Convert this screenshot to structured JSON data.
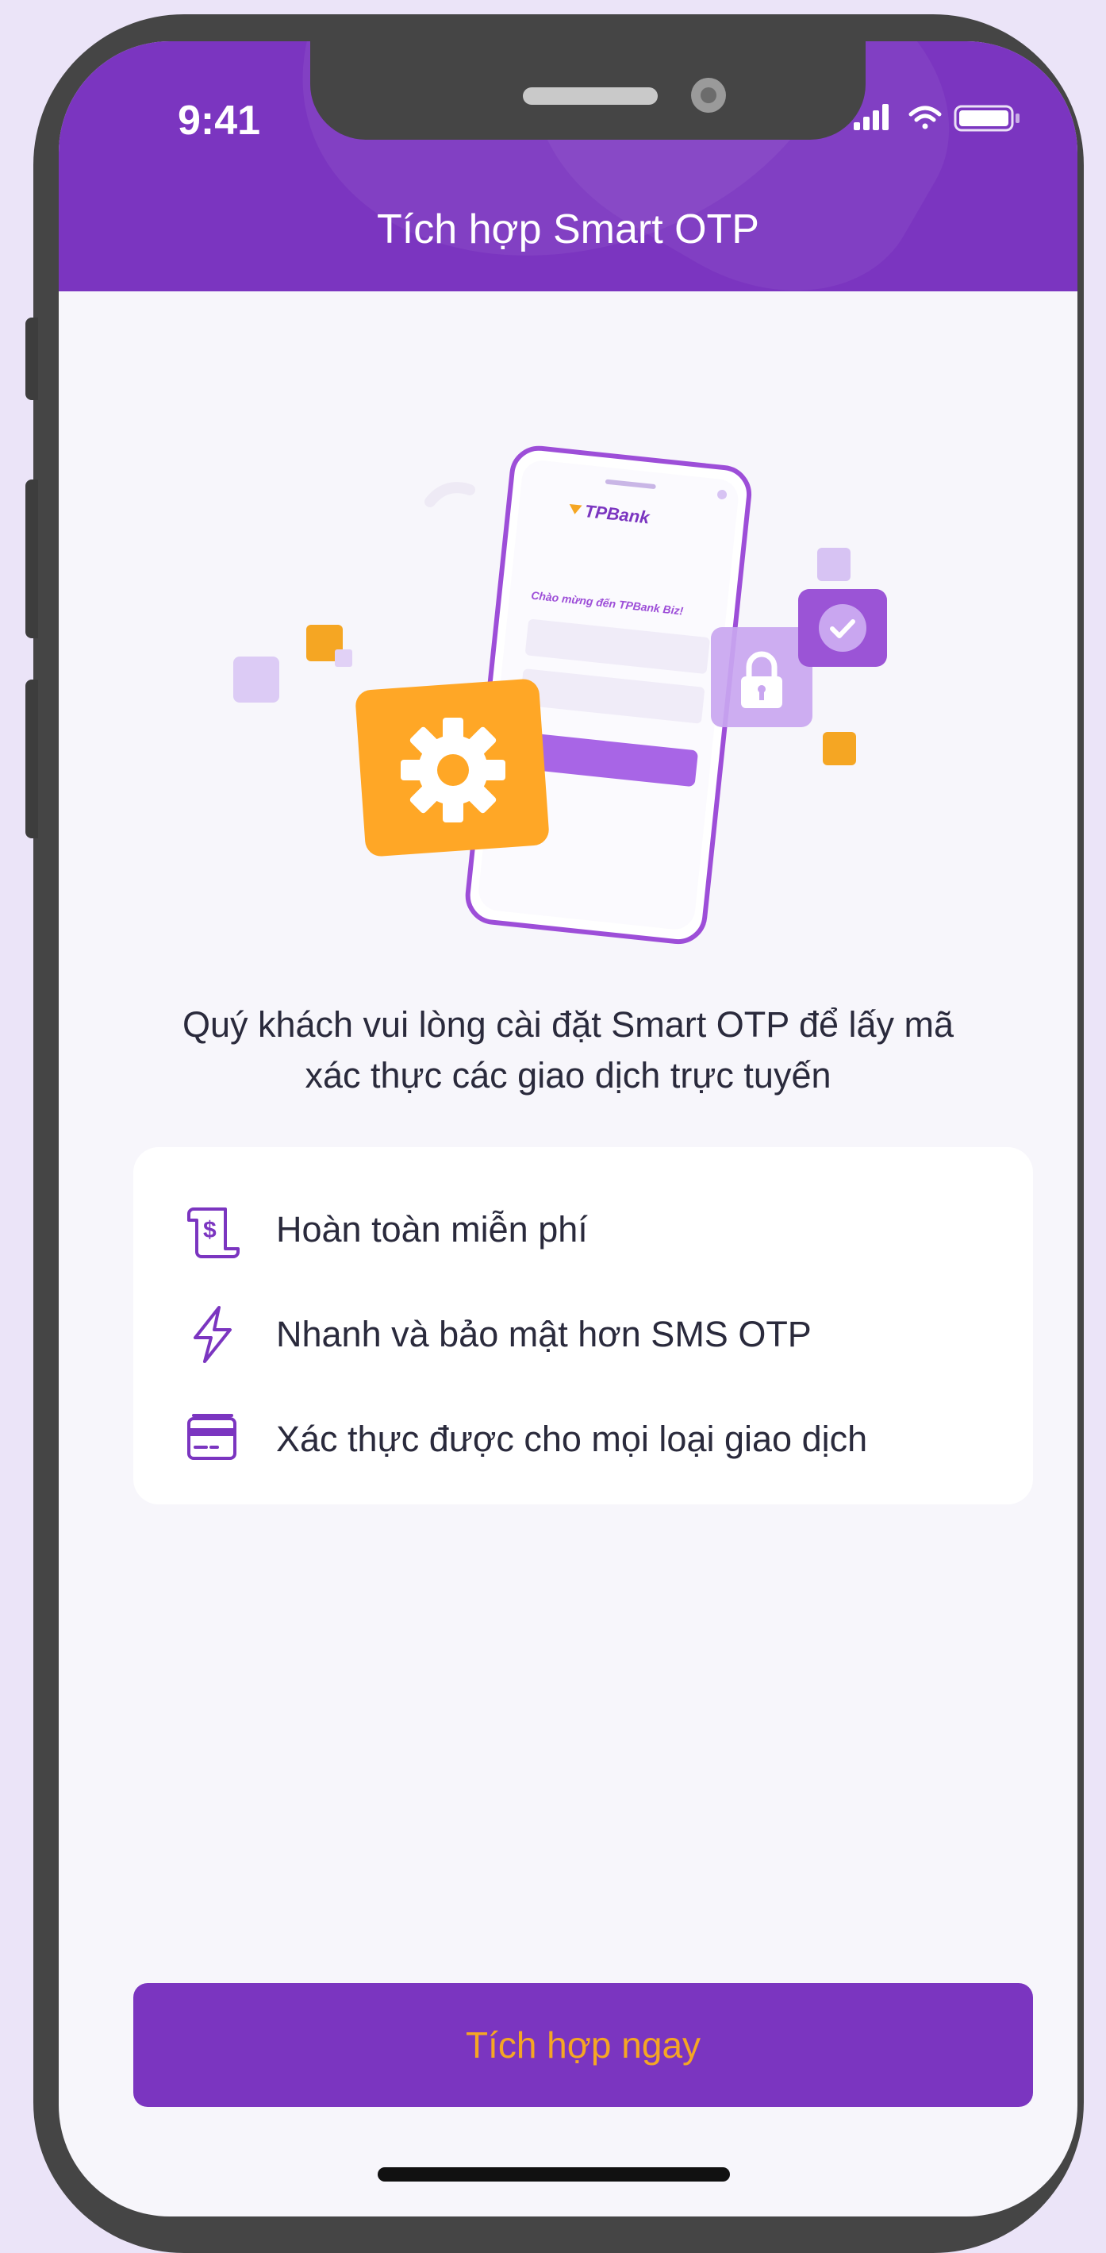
{
  "status_bar": {
    "time": "9:41"
  },
  "header": {
    "title": "Tích hợp Smart OTP"
  },
  "illustration": {
    "bank_logo": "TPBank",
    "welcome": "Chào mừng đến TPBank Biz!"
  },
  "message": {
    "line1": "Quý khách vui lòng cài đặt Smart OTP để lấy mã",
    "line2": "xác thực các giao dịch trực tuyến"
  },
  "features": [
    {
      "icon": "receipt-dollar-icon",
      "label": "Hoàn toàn miễn phí"
    },
    {
      "icon": "lightning-icon",
      "label": "Nhanh và bảo mật hơn SMS OTP"
    },
    {
      "icon": "card-icon",
      "label": "Xác thực được cho mọi loại giao dịch"
    }
  ],
  "cta": {
    "label": "Tích hợp ngay"
  },
  "colors": {
    "primary": "#7b35c0",
    "accent": "#f5a623",
    "background": "#f7f6fb"
  }
}
